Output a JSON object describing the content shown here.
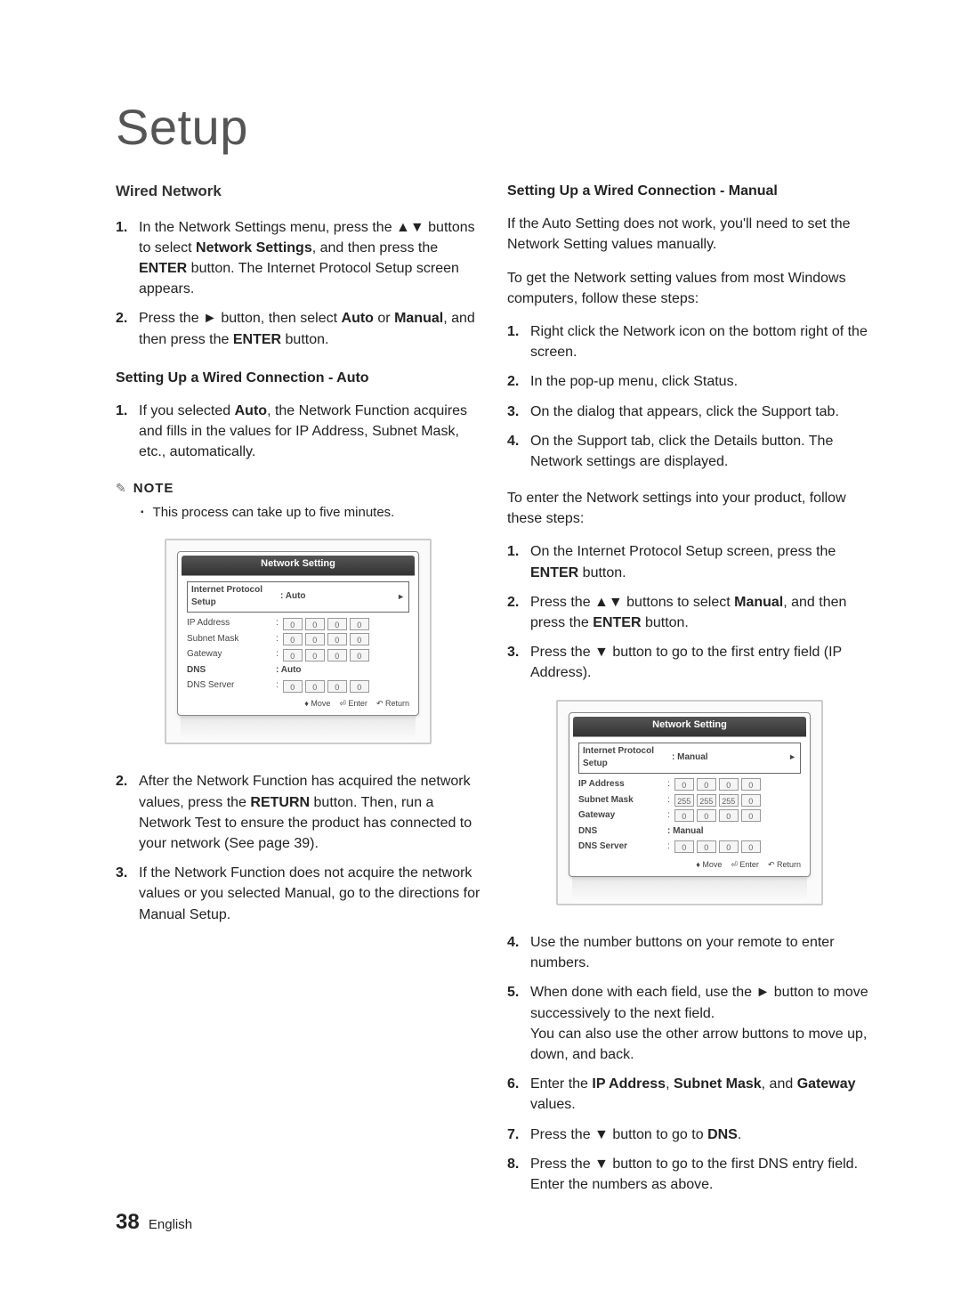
{
  "chapter": "Setup",
  "left": {
    "heading": "Wired Network",
    "intro_steps": [
      {
        "n": "1.",
        "pre": "In the Network Settings menu, press the ▲▼ buttons to select ",
        "bold": "Network Settings",
        "post": ", and then press the ",
        "bold2": "ENTER",
        "post2": " button.\nThe Internet Protocol Setup screen appears."
      },
      {
        "n": "2.",
        "pre": "Press the ► button, then select ",
        "bold": "Auto",
        "mid": " or ",
        "bold2": "Manual",
        "post": ", and then press the ",
        "bold3": "ENTER",
        "post2": " button."
      }
    ],
    "auto_heading": "Setting Up a Wired Connection - Auto",
    "auto_step": {
      "n": "1.",
      "pre": "If you selected ",
      "bold": "Auto",
      "post": ", the Network Function acquires and fills in the values for IP Address, Subnet Mask, etc., automatically."
    },
    "note_label": "NOTE",
    "note_bullet": "This process can take up to five minutes.",
    "screen1": {
      "title": "Network Setting",
      "protocol_label": "Internet Protocol Setup",
      "protocol_value": ": Auto",
      "rows": [
        {
          "label": "IP Address",
          "octets": [
            "0",
            "0",
            "0",
            "0"
          ],
          "disabled": true
        },
        {
          "label": "Subnet Mask",
          "octets": [
            "0",
            "0",
            "0",
            "0"
          ],
          "disabled": true
        },
        {
          "label": "Gateway",
          "octets": [
            "0",
            "0",
            "0",
            "0"
          ],
          "disabled": true
        }
      ],
      "dns_label": "DNS",
      "dns_value": ": Auto",
      "dns_server_label": "DNS Server",
      "dns_server_octets": [
        "0",
        "0",
        "0",
        "0"
      ],
      "footer": {
        "move": "Move",
        "enter": "Enter",
        "return": "Return"
      }
    },
    "post_steps": [
      {
        "n": "2.",
        "pre": "After the Network Function has acquired the network values, press the ",
        "bold": "RETURN",
        "post": " button. Then, run a Network Test to ensure the product has connected to your network (See page 39)."
      },
      {
        "n": "3.",
        "txt": "If the Network Function does not acquire the network values or you selected Manual, go to the directions for Manual Setup."
      }
    ]
  },
  "right": {
    "manual_heading": "Setting Up a Wired Connection - Manual",
    "para1": "If the Auto Setting does not work, you'll need to set the Network Setting values manually.",
    "para2": "To get the Network setting values from most Windows computers, follow these steps:",
    "win_steps": [
      {
        "n": "1.",
        "txt": "Right click the Network icon on the bottom right of the screen."
      },
      {
        "n": "2.",
        "txt": "In the pop-up menu, click Status."
      },
      {
        "n": "3.",
        "txt": "On the dialog that appears, click the Support tab."
      },
      {
        "n": "4.",
        "txt": "On the Support tab, click the Details button. The Network settings are displayed."
      }
    ],
    "para3": "To enter the Network settings into your product, follow these steps:",
    "enter_steps_a": [
      {
        "n": "1.",
        "pre": "On the Internet Protocol Setup screen, press the ",
        "bold": "ENTER",
        "post": " button."
      },
      {
        "n": "2.",
        "pre": "Press the ▲▼ buttons to select ",
        "bold": "Manual",
        "post": ", and then press the ",
        "bold2": "ENTER",
        "post2": " button."
      },
      {
        "n": "3.",
        "txt": "Press the ▼ button to go to the first entry field (IP Address)."
      }
    ],
    "screen2": {
      "title": "Network Setting",
      "protocol_label": "Internet Protocol Setup",
      "protocol_value": ": Manual",
      "rows": [
        {
          "label": "IP Address",
          "octets": [
            "0",
            "0",
            "0",
            "0"
          ]
        },
        {
          "label": "Subnet Mask",
          "octets": [
            "255",
            "255",
            "255",
            "0"
          ]
        },
        {
          "label": "Gateway",
          "octets": [
            "0",
            "0",
            "0",
            "0"
          ]
        }
      ],
      "dns_label": "DNS",
      "dns_value": ": Manual",
      "dns_server_label": "DNS Server",
      "dns_server_octets": [
        "0",
        "0",
        "0",
        "0"
      ],
      "footer": {
        "move": "Move",
        "enter": "Enter",
        "return": "Return"
      }
    },
    "enter_steps_b": [
      {
        "n": "4.",
        "txt": "Use the number buttons on your remote to enter numbers."
      },
      {
        "n": "5.",
        "txt": "When done with each field, use the ► button to move successively to the next field.\nYou can also use the other arrow buttons to move up, down, and back."
      },
      {
        "n": "6.",
        "pre": "Enter the ",
        "bold": "IP Address",
        "mid": ", ",
        "bold2": "Subnet Mask",
        "mid2": ", and ",
        "bold3": "Gateway",
        "post": " values."
      },
      {
        "n": "7.",
        "pre": "Press the ▼ button to go to ",
        "bold": "DNS",
        "post": "."
      },
      {
        "n": "8.",
        "txt": "Press the ▼ button to go to the first DNS entry field. Enter the numbers as above."
      }
    ]
  },
  "footer": {
    "page": "38",
    "lang": "English"
  }
}
